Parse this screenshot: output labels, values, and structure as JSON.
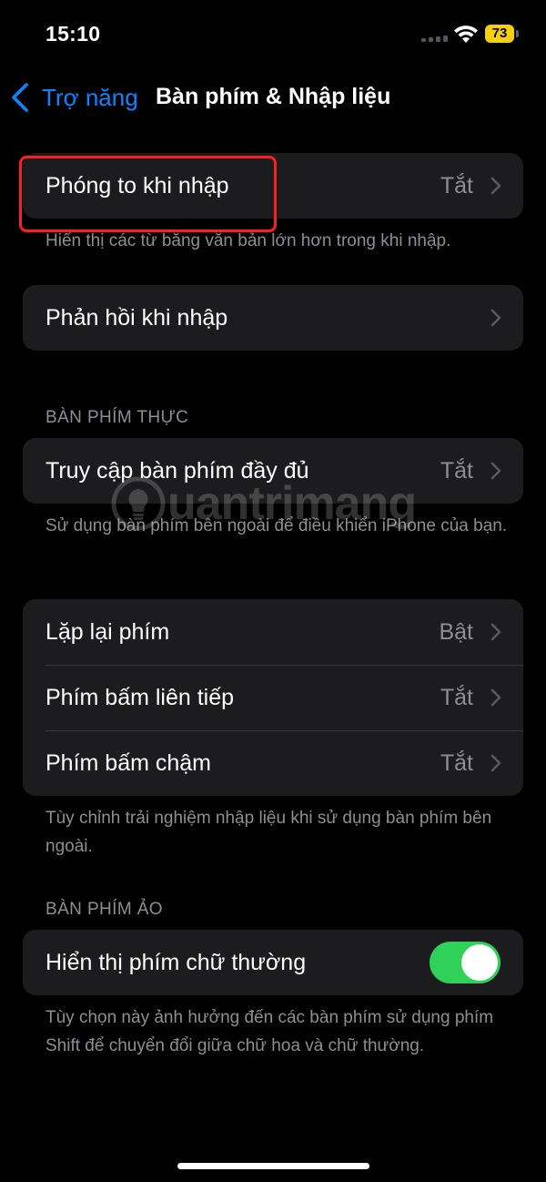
{
  "status_bar": {
    "time": "15:10",
    "battery": "73"
  },
  "nav": {
    "back_label": "Trợ năng",
    "title": "Bàn phím & Nhập liệu"
  },
  "groups": {
    "typing_zoom": {
      "label": "Phóng to khi nhập",
      "value": "Tắt",
      "footer": "Hiển thị các từ bằng văn bản lớn hơn trong khi nhập."
    },
    "typing_feedback": {
      "label": "Phản hồi khi nhập"
    },
    "hardware": {
      "header": "BÀN PHÍM THỰC",
      "full_access": {
        "label": "Truy cập bàn phím đầy đủ",
        "value": "Tắt"
      },
      "full_access_footer": "Sử dụng bàn phím bên ngoài để điều khiển iPhone của bạn.",
      "rows": [
        {
          "label": "Lặp lại phím",
          "value": "Bật"
        },
        {
          "label": "Phím bấm liên tiếp",
          "value": "Tắt"
        },
        {
          "label": "Phím bấm chậm",
          "value": "Tắt"
        }
      ],
      "rows_footer": "Tùy chỉnh trải nghiệm nhập liệu khi sử dụng bàn phím bên ngoài."
    },
    "software": {
      "header": "BÀN PHÍM ẢO",
      "lowercase": {
        "label": "Hiển thị phím chữ thường",
        "on": true
      },
      "footer": "Tùy chọn này ảnh hưởng đến các bàn phím sử dụng phím Shift để chuyển đổi giữa chữ hoa và chữ thường."
    }
  },
  "watermark": {
    "text": "uantrimang"
  },
  "colors": {
    "accent": "#0a84ff",
    "toggle_on": "#30d158",
    "highlight": "#ff1e1e",
    "battery": "#f5d10a"
  },
  "icons": [
    "wifi-icon",
    "battery-icon",
    "back-chevron-icon",
    "chevron-right-icon",
    "lightbulb-logo-icon"
  ]
}
